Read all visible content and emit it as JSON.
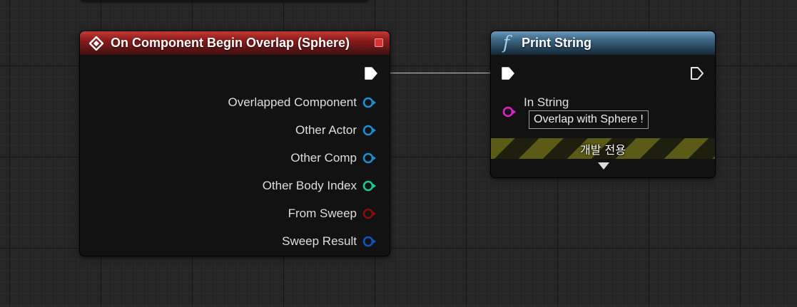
{
  "event_node": {
    "title": "On Component Begin Overlap (Sphere)",
    "header_color": "#9b1f1f",
    "icon": "event-diamond-icon",
    "pins": [
      {
        "label": "Overlapped Component",
        "color": "#1c8fd0"
      },
      {
        "label": "Other Actor",
        "color": "#1c8fd0"
      },
      {
        "label": "Other Comp",
        "color": "#1c8fd0"
      },
      {
        "label": "Other Body Index",
        "color": "#20c896"
      },
      {
        "label": "From Sweep",
        "color": "#8a0c0c"
      },
      {
        "label": "Sweep Result",
        "color": "#0e57b8"
      }
    ]
  },
  "func_node": {
    "title": "Print String",
    "icon_glyph": "f",
    "header_color": "#3d6885",
    "in_string_label": "In String",
    "in_string_value": "Overlap with Sphere !",
    "in_string_pin_color": "#e020c8",
    "dev_only_label": "개발 전용"
  }
}
